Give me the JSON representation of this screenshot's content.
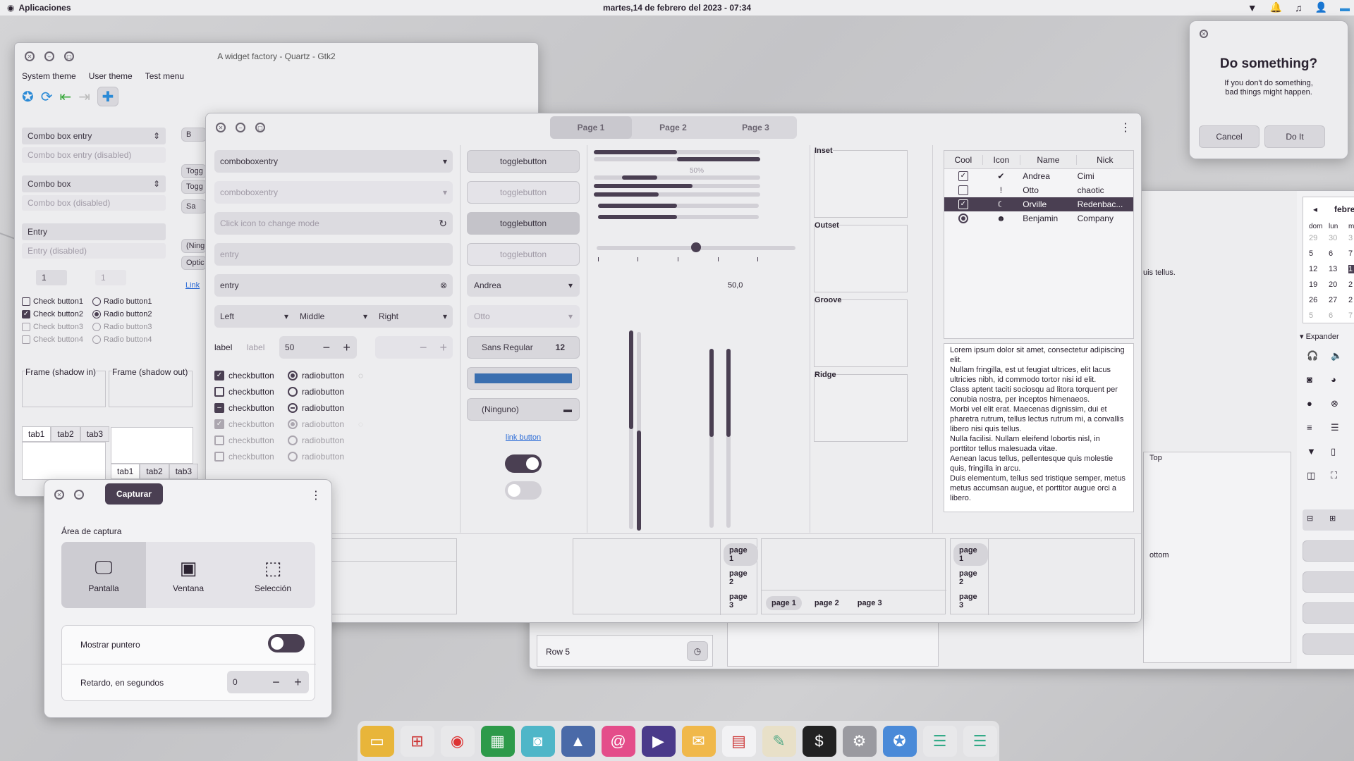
{
  "topbar": {
    "apps": "Aplicaciones",
    "clock": "martes,14 de febrero del 2023 - 07:34"
  },
  "wf_back": {
    "title": "A widget factory - Quartz - Gtk2",
    "menu": [
      "System theme",
      "User theme",
      "Test menu"
    ],
    "combo_entry": "Combo box entry",
    "combo_entry_dis": "Combo box entry (disabled)",
    "combo": "Combo box",
    "combo_dis": "Combo box (disabled)",
    "entry": "Entry",
    "entry_dis": "Entry (disabled)",
    "spin1": "1",
    "spin2": "1",
    "checks": [
      "Check button1",
      "Check button2",
      "Check button3",
      "Check button4"
    ],
    "radios": [
      "Radio button1",
      "Radio button2",
      "Radio button3",
      "Radio button4"
    ],
    "frame_in": "Frame (shadow in)",
    "frame_out": "Frame (shadow out)",
    "tabs": [
      "tab1",
      "tab2",
      "tab3"
    ],
    "tabs2": [
      "tab1",
      "tab2",
      "tab3"
    ],
    "side": [
      "B",
      "Togg",
      "Togg",
      "Sa",
      "(Ning",
      "Optic",
      "Link"
    ]
  },
  "wf": {
    "tabs": [
      "Page 1",
      "Page 2",
      "Page 3"
    ],
    "combo1": "comboboxentry",
    "combo2": "comboboxentry",
    "icon_entry": "Click icon to change mode",
    "entry1": "entry",
    "entry2": "entry",
    "align": [
      "Left",
      "Middle",
      "Right"
    ],
    "label1": "label",
    "label2": "label",
    "spin": "50",
    "checks": [
      "checkbutton",
      "checkbutton",
      "checkbutton",
      "checkbutton",
      "checkbutton",
      "checkbutton"
    ],
    "radios": [
      "radiobutton",
      "radiobutton",
      "radiobutton",
      "radiobutton",
      "radiobutton",
      "radiobutton"
    ],
    "toggles": [
      "togglebutton",
      "togglebutton",
      "togglebutton",
      "togglebutton"
    ],
    "combo_andrea": "Andrea",
    "combo_otto": "Otto",
    "font": "Sans Regular",
    "font_size": "12",
    "file": "(Ninguno)",
    "link": "link button",
    "progress_label": "50%",
    "scale_value": "50,0",
    "frames": [
      "Inset",
      "Outset",
      "Groove",
      "Ridge"
    ],
    "tree_headers": [
      "Cool",
      "Icon",
      "Name",
      "Nick"
    ],
    "tree": [
      {
        "name": "Andrea",
        "nick": "Cimi"
      },
      {
        "name": "Otto",
        "nick": "chaotic"
      },
      {
        "name": "Orville",
        "nick": "Redenbac..."
      },
      {
        "name": "Benjamin",
        "nick": "Company"
      }
    ],
    "lorem": "Lorem ipsum dolor sit amet, consectetur adipiscing elit.\nNullam fringilla, est ut feugiat ultrices, elit lacus ultricies nibh, id commodo tortor nisi id elit.\nClass aptent taciti sociosqu ad litora torquent per conubia nostra, per inceptos himenaeos.\nMorbi vel elit erat. Maecenas dignissim, dui et pharetra rutrum, tellus lectus rutrum mi, a convallis libero nisi quis tellus.\nNulla facilisi. Nullam eleifend lobortis nisl, in porttitor tellus malesuada vitae.\nAenean lacus tellus, pellentesque quis molestie quis, fringilla in arcu.\nDuis elementum, tellus sed tristique semper, metus metus accumsan augue, et porttitor augue orci a libero.",
    "pages": [
      "page 1",
      "page 2",
      "page 3"
    ],
    "frag3": "3"
  },
  "dialog": {
    "title": "Do something?",
    "text": "If you don't do something,\nbad things might happen.",
    "cancel": "Cancel",
    "do": "Do It"
  },
  "capture": {
    "title": "Capturar",
    "area": "Área de captura",
    "modes": [
      "Pantalla",
      "Ventana",
      "Selección"
    ],
    "pointer": "Mostrar puntero",
    "delay": "Retardo, en segundos",
    "delay_val": "0"
  },
  "right_win": {
    "month": "febrero",
    "days": [
      "dom",
      "lun",
      "m"
    ],
    "cal": [
      [
        "29",
        "30",
        "3"
      ],
      [
        "5",
        "6",
        "7"
      ],
      [
        "12",
        "13",
        "1"
      ],
      [
        "19",
        "20",
        "2"
      ],
      [
        "26",
        "27",
        "2"
      ],
      [
        "5",
        "6",
        "7"
      ]
    ],
    "expander": "Expander",
    "frag_tellus": "uis tellus.",
    "frag_top": "Top",
    "frag_bottom": "ottom",
    "row5": "Row 5"
  }
}
